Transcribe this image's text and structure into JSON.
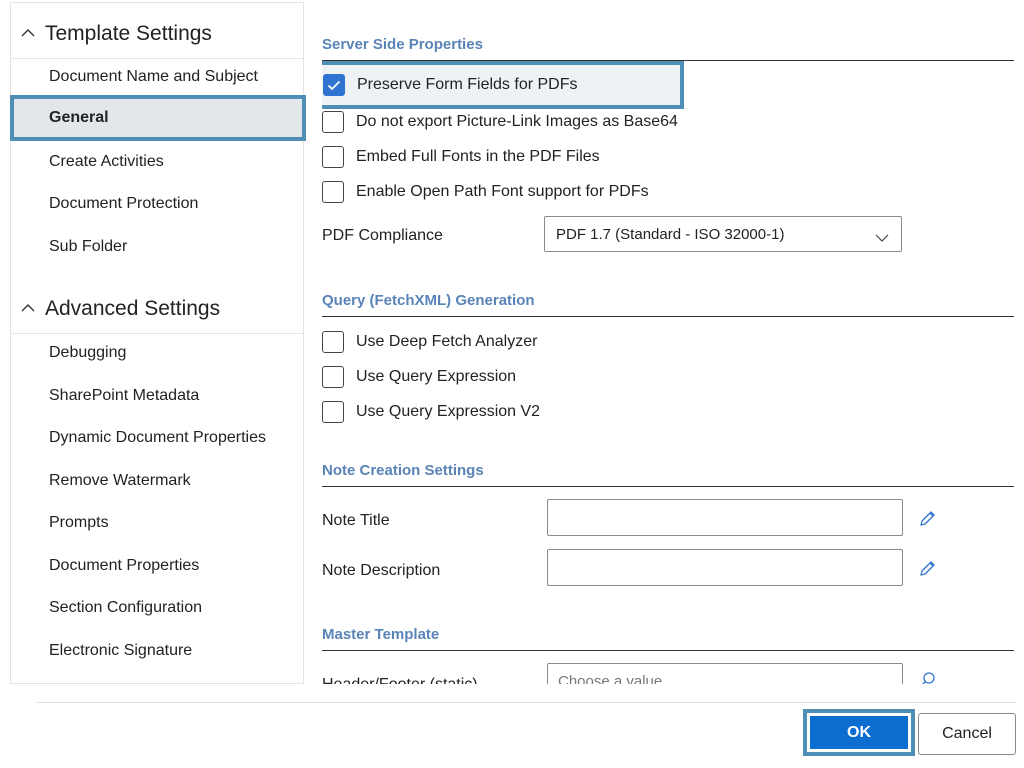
{
  "sidebar": {
    "template_settings": {
      "title": "Template Settings",
      "items": [
        {
          "label": "Document Name and Subject"
        },
        {
          "label": "General"
        },
        {
          "label": "Create Activities"
        },
        {
          "label": "Document Protection"
        },
        {
          "label": "Sub Folder"
        }
      ]
    },
    "advanced_settings": {
      "title": "Advanced Settings",
      "items": [
        {
          "label": "Debugging"
        },
        {
          "label": "SharePoint Metadata"
        },
        {
          "label": "Dynamic Document Properties"
        },
        {
          "label": "Remove Watermark"
        },
        {
          "label": "Prompts"
        },
        {
          "label": "Document Properties"
        },
        {
          "label": "Section Configuration"
        },
        {
          "label": "Electronic Signature"
        }
      ]
    },
    "selected_item": "General"
  },
  "server_side": {
    "title": "Server Side Properties",
    "checkboxes": [
      {
        "label": "Preserve Form Fields for PDFs",
        "checked": true
      },
      {
        "label": "Do not export Picture-Link Images as Base64",
        "checked": false
      },
      {
        "label": "Embed Full Fonts in the PDF Files",
        "checked": false
      },
      {
        "label": "Enable Open Path Font support for PDFs",
        "checked": false
      }
    ],
    "pdf_compliance": {
      "label": "PDF Compliance",
      "value": "PDF 1.7 (Standard - ISO 32000-1)"
    }
  },
  "query": {
    "title": "Query (FetchXML) Generation",
    "checkboxes": [
      {
        "label": "Use Deep Fetch Analyzer",
        "checked": false
      },
      {
        "label": "Use Query Expression",
        "checked": false
      },
      {
        "label": "Use Query Expression V2",
        "checked": false
      }
    ]
  },
  "note": {
    "title": "Note Creation Settings",
    "note_title": {
      "label": "Note Title",
      "value": ""
    },
    "note_description": {
      "label": "Note Description",
      "value": ""
    }
  },
  "master": {
    "title": "Master Template",
    "header_footer": {
      "label": "Header/Footer (static)",
      "placeholder": "Choose a value"
    }
  },
  "footer": {
    "ok_label": "OK",
    "cancel_label": "Cancel"
  },
  "colors": {
    "accent": "#0b6dd0",
    "highlight_outline": "#4f8fb6",
    "section_title": "#5a84b8",
    "checkbox_checked": "#2f74d0"
  },
  "icons": {
    "collapse": "chevron-up-icon",
    "pencil": "pencil-icon",
    "search": "search-icon",
    "dropdown": "chevron-down-icon",
    "check": "checkmark-icon"
  }
}
